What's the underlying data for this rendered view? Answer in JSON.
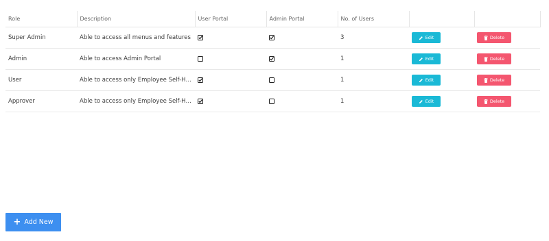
{
  "table": {
    "headers": {
      "role": "Role",
      "description": "Description",
      "user_portal": "User Portal",
      "admin_portal": "Admin Portal",
      "num_users": "No. of Users",
      "edit_col": "",
      "delete_col": ""
    },
    "rows": [
      {
        "role": "Super Admin",
        "description": "Able to access all menus and features",
        "user_portal": true,
        "admin_portal": true,
        "num_users": "3",
        "edit_label": "Edit",
        "delete_label": "Delete"
      },
      {
        "role": "Admin",
        "description": "Able to access Admin Portal",
        "user_portal": false,
        "admin_portal": true,
        "num_users": "1",
        "edit_label": "Edit",
        "delete_label": "Delete"
      },
      {
        "role": "User",
        "description": "Able to access only Employee Self-Help Portal",
        "user_portal": true,
        "admin_portal": false,
        "num_users": "1",
        "edit_label": "Edit",
        "delete_label": "Delete"
      },
      {
        "role": "Approver",
        "description": "Able to access only Employee Self-Help Portal",
        "user_portal": true,
        "admin_portal": false,
        "num_users": "1",
        "edit_label": "Edit",
        "delete_label": "Delete"
      }
    ]
  },
  "add_button": {
    "label": "Add New",
    "icon": "plus-icon"
  },
  "colors": {
    "edit_button": "#1ab9d6",
    "delete_button": "#f4566f",
    "add_button": "#3d8ff0"
  }
}
